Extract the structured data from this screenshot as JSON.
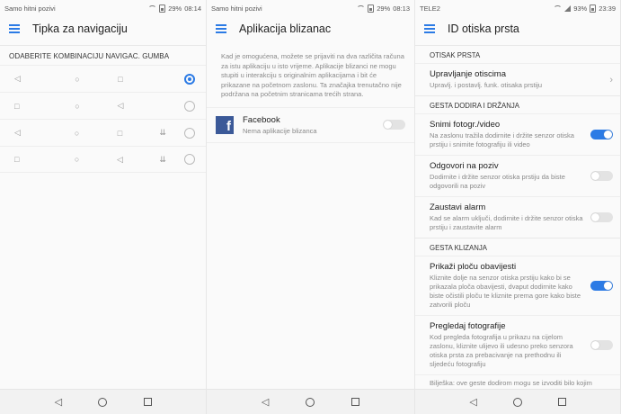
{
  "panel1": {
    "status_left": "Samo hitni pozivi",
    "status_right": "29%",
    "time": "08:14",
    "title": "Tipka za navigaciju",
    "section": "ODABERITE KOMBINACIJU NAVIGAC. GUMBA",
    "rows": [
      {
        "keys": [
          "◁",
          "○",
          "□"
        ],
        "selected": true
      },
      {
        "keys": [
          "□",
          "○",
          "◁"
        ],
        "selected": false
      },
      {
        "keys": [
          "◁",
          "○",
          "□",
          "⇊"
        ],
        "selected": false
      },
      {
        "keys": [
          "□",
          "○",
          "◁",
          "⇊"
        ],
        "selected": false
      }
    ]
  },
  "panel2": {
    "status_left": "Samo hitni pozivi",
    "status_right": "29%",
    "time": "08:13",
    "title": "Aplikacija blizanac",
    "description": "Kad je omogućena, možete se prijaviti na dva različita računa za istu aplikaciju u isto vrijeme. Aplikacije blizanci ne mogu stupiti u interakciju s originalnim aplikacijama i bit će prikazane na početnom zaslonu. Ta značajka trenutačno nije podržana na početnim stranicama trećih strana.",
    "app": {
      "name": "Facebook",
      "sub": "Nema aplikacije blizanca",
      "enabled": false
    }
  },
  "panel3": {
    "status_left": "TELE2",
    "status_right": "93%",
    "time": "23:39",
    "title": "ID otiska prsta",
    "sections": [
      {
        "header": "OTISAK PRSTA",
        "items": [
          {
            "name": "Upravljanje otiscima",
            "sub": "Upravlj. i postavlj. funk. otisaka prstiju",
            "type": "chevron"
          }
        ]
      },
      {
        "header": "GESTA DODIRA I DRŽANJA",
        "items": [
          {
            "name": "Snimi fotogr./video",
            "sub": "Na zaslonu tražila dodirnite i držite senzor otiska prstiju i snimite fotografiju ili video",
            "type": "toggle",
            "on": true
          },
          {
            "name": "Odgovori na poziv",
            "sub": "Dodirnite i držite senzor otiska prstiju da biste odgovorili na poziv",
            "type": "toggle",
            "on": false
          },
          {
            "name": "Zaustavi alarm",
            "sub": "Kad se alarm uključi, dodirnite i držite senzor otiska prstiju i zaustavite alarm",
            "type": "toggle",
            "on": false
          }
        ]
      },
      {
        "header": "GESTA KLIZANJA",
        "items": [
          {
            "name": "Prikaži ploču obavijesti",
            "sub": "Kliznite dolje na senzor otiska prstiju kako bi se prikazala ploča obavijesti, dvaput dodirnite kako biste očistili ploču te kliznite prema gore kako biste zatvorili ploču",
            "type": "toggle",
            "on": true
          },
          {
            "name": "Pregledaj fotografije",
            "sub": "Kod pregleda fotografija u prikazu na cijelom zaslonu, kliznite ulijevo ili udesno preko senzora otiska prsta za prebacivanje na prethodnu ili sljedeću fotografiju",
            "type": "toggle",
            "on": false
          }
        ]
      }
    ],
    "note": "Bilješka: ove geste dodirom mogu se izvoditi bilo kojim prstom i nije potreban otisak prsta."
  },
  "navbar": {
    "back": "◁",
    "home": "○",
    "recents": "□"
  },
  "colors": {
    "accent": "#2c7be5",
    "facebook": "#3b5998"
  }
}
